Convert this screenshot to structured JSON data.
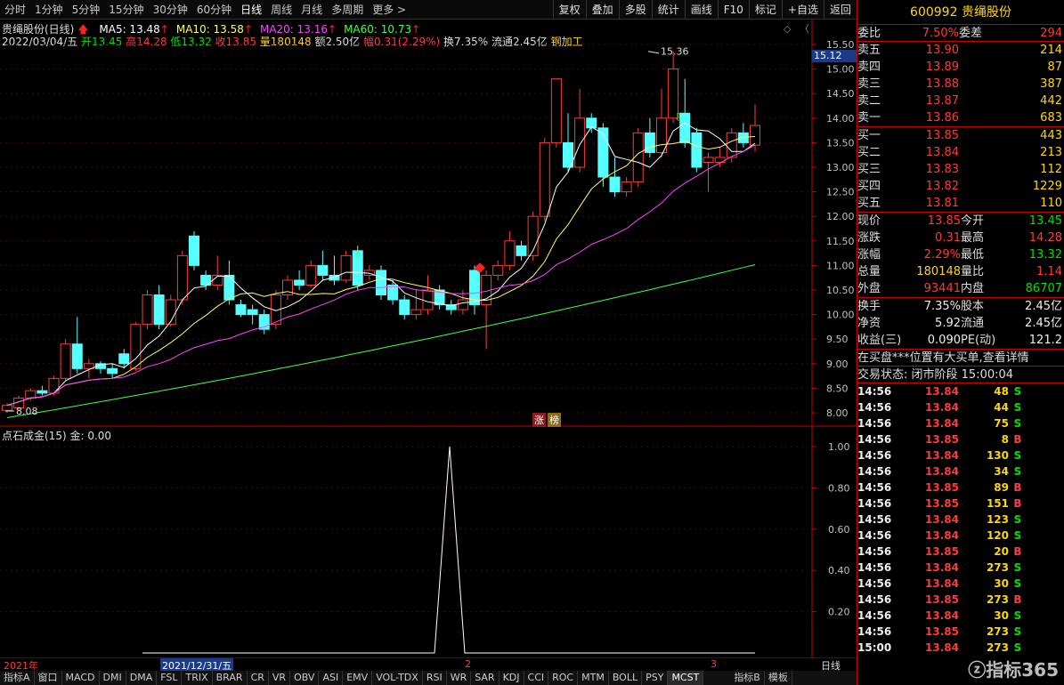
{
  "periods": [
    "分时",
    "1分钟",
    "5分钟",
    "15分钟",
    "30分钟",
    "60分钟",
    "日线",
    "周线",
    "月线",
    "多周期",
    "更多 >"
  ],
  "toolbar": [
    "复权",
    "叠加",
    "多股",
    "统计",
    "画线",
    "F10",
    "标记",
    "+自选",
    "返回"
  ],
  "chart": {
    "title": "贵绳股份(日线)",
    "ma": [
      {
        "label": "MA5: 13.48",
        "color": "#ffffff"
      },
      {
        "label": "MA10: 13.58",
        "color": "#ffff66"
      },
      {
        "label": "MA20: 13.16",
        "color": "#ff44ff"
      },
      {
        "label": "MA60: 10.73",
        "color": "#44ff44"
      }
    ],
    "bar_info": {
      "date": "2022/03/04/五",
      "open": "开13.45",
      "high": "高14.28",
      "low": "低13.32",
      "close": "收13.85",
      "vol": "量180148",
      "amount": "额2.50亿",
      "range": "幅0.31(2.29%)",
      "turnover": "换7.35%",
      "float": "流通2.45亿",
      "industry": "钢加工"
    },
    "max_label": "15.36",
    "min_label": "8.08",
    "current_price_tag": "15.12",
    "yaxis": [
      "15.50",
      "15.00",
      "14.50",
      "14.00",
      "13.50",
      "13.00",
      "12.50",
      "12.00",
      "11.50",
      "11.00",
      "10.50",
      "10.00",
      "9.50",
      "9.00",
      "8.50",
      "8.00"
    ],
    "ranking_tag": [
      "涨",
      "榜"
    ],
    "indicator_title": "点石成金(15)",
    "indicator_value": "金: 0.00",
    "ind_yaxis": [
      "1.00",
      "0.80",
      "0.60",
      "0.40",
      "0.20"
    ],
    "xaxis": {
      "year": "2021年",
      "cursor_date": "2021/12/31/五",
      "m2": "2",
      "m3": "3",
      "mode": "日线"
    }
  },
  "bottom_tabs": [
    "指标A",
    "窗口",
    "MACD",
    "DMI",
    "DMA",
    "FSL",
    "TRIX",
    "BRAR",
    "CR",
    "VR",
    "OBV",
    "ASI",
    "EMV",
    "VOL-TDX",
    "RSI",
    "WR",
    "SAR",
    "KDJ",
    "CCI",
    "ROC",
    "MTM",
    "BOLL",
    "PSY",
    "MCST",
    "指标B",
    "模板"
  ],
  "quote": {
    "code": "600992",
    "name": "贵绳股份",
    "weibi_label": "委比",
    "weibi": "7.50%",
    "weicha_label": "委差",
    "weicha": "294",
    "sell": [
      {
        "label": "卖五",
        "price": "13.90",
        "vol": "214"
      },
      {
        "label": "卖四",
        "price": "13.89",
        "vol": "87"
      },
      {
        "label": "卖三",
        "price": "13.88",
        "vol": "387"
      },
      {
        "label": "卖二",
        "price": "13.87",
        "vol": "442"
      },
      {
        "label": "卖一",
        "price": "13.86",
        "vol": "683"
      }
    ],
    "buy": [
      {
        "label": "买一",
        "price": "13.85",
        "vol": "443"
      },
      {
        "label": "买二",
        "price": "13.84",
        "vol": "213"
      },
      {
        "label": "买三",
        "price": "13.83",
        "vol": "112"
      },
      {
        "label": "买四",
        "price": "13.82",
        "vol": "1229"
      },
      {
        "label": "买五",
        "price": "13.81",
        "vol": "110"
      }
    ],
    "stats": [
      {
        "l1": "现价",
        "v1": "13.85",
        "c1": "red",
        "l2": "今开",
        "v2": "13.45",
        "c2": "green"
      },
      {
        "l1": "涨跌",
        "v1": "0.31",
        "c1": "red",
        "l2": "最高",
        "v2": "14.28",
        "c2": "red"
      },
      {
        "l1": "涨幅",
        "v1": "2.29%",
        "c1": "red",
        "l2": "最低",
        "v2": "13.32",
        "c2": "green"
      },
      {
        "l1": "总量",
        "v1": "180148",
        "c1": "yellow",
        "l2": "量比",
        "v2": "1.14",
        "c2": "red"
      },
      {
        "l1": "外盘",
        "v1": "93441",
        "c1": "red",
        "l2": "内盘",
        "v2": "86707",
        "c2": "green"
      }
    ],
    "fin": [
      {
        "l1": "换手",
        "v1": "7.35%",
        "l2": "股本",
        "v2": "2.45亿"
      },
      {
        "l1": "净资",
        "v1": "5.92",
        "l2": "流通",
        "v2": "2.45亿"
      },
      {
        "l1": "收益(三)",
        "v1": "0.090",
        "l2": "PE(动)",
        "v2": "121.2"
      }
    ],
    "notice": "在买盘***位置有大买单,查看详情",
    "status": "交易状态: 闭市阶段 15:00:04",
    "ticks": [
      {
        "t": "14:56",
        "p": "13.84",
        "v": "48",
        "d": "S"
      },
      {
        "t": "14:56",
        "p": "13.84",
        "v": "44",
        "d": "S"
      },
      {
        "t": "14:56",
        "p": "13.84",
        "v": "75",
        "d": "S"
      },
      {
        "t": "14:56",
        "p": "13.85",
        "v": "8",
        "d": "B"
      },
      {
        "t": "14:56",
        "p": "13.84",
        "v": "130",
        "d": "S"
      },
      {
        "t": "14:56",
        "p": "13.84",
        "v": "34",
        "d": "S"
      },
      {
        "t": "14:56",
        "p": "13.85",
        "v": "89",
        "d": "B"
      },
      {
        "t": "14:56",
        "p": "13.85",
        "v": "151",
        "d": "B"
      },
      {
        "t": "14:56",
        "p": "13.84",
        "v": "123",
        "d": "S"
      },
      {
        "t": "14:56",
        "p": "13.84",
        "v": "120",
        "d": "S"
      },
      {
        "t": "14:56",
        "p": "13.85",
        "v": "20",
        "d": "B"
      },
      {
        "t": "14:56",
        "p": "13.84",
        "v": "273",
        "d": "S"
      },
      {
        "t": "14:56",
        "p": "13.84",
        "v": "30",
        "d": "S"
      },
      {
        "t": "14:56",
        "p": "13.85",
        "v": "273",
        "d": "B"
      },
      {
        "t": "14:56",
        "p": "13.84",
        "v": "30",
        "d": "S"
      },
      {
        "t": "14:56",
        "p": "13.85",
        "v": "273",
        "d": "S"
      },
      {
        "t": "15:00",
        "p": "13.84",
        "v": "273",
        "d": "S"
      }
    ],
    "watermark": "指标365"
  }
}
